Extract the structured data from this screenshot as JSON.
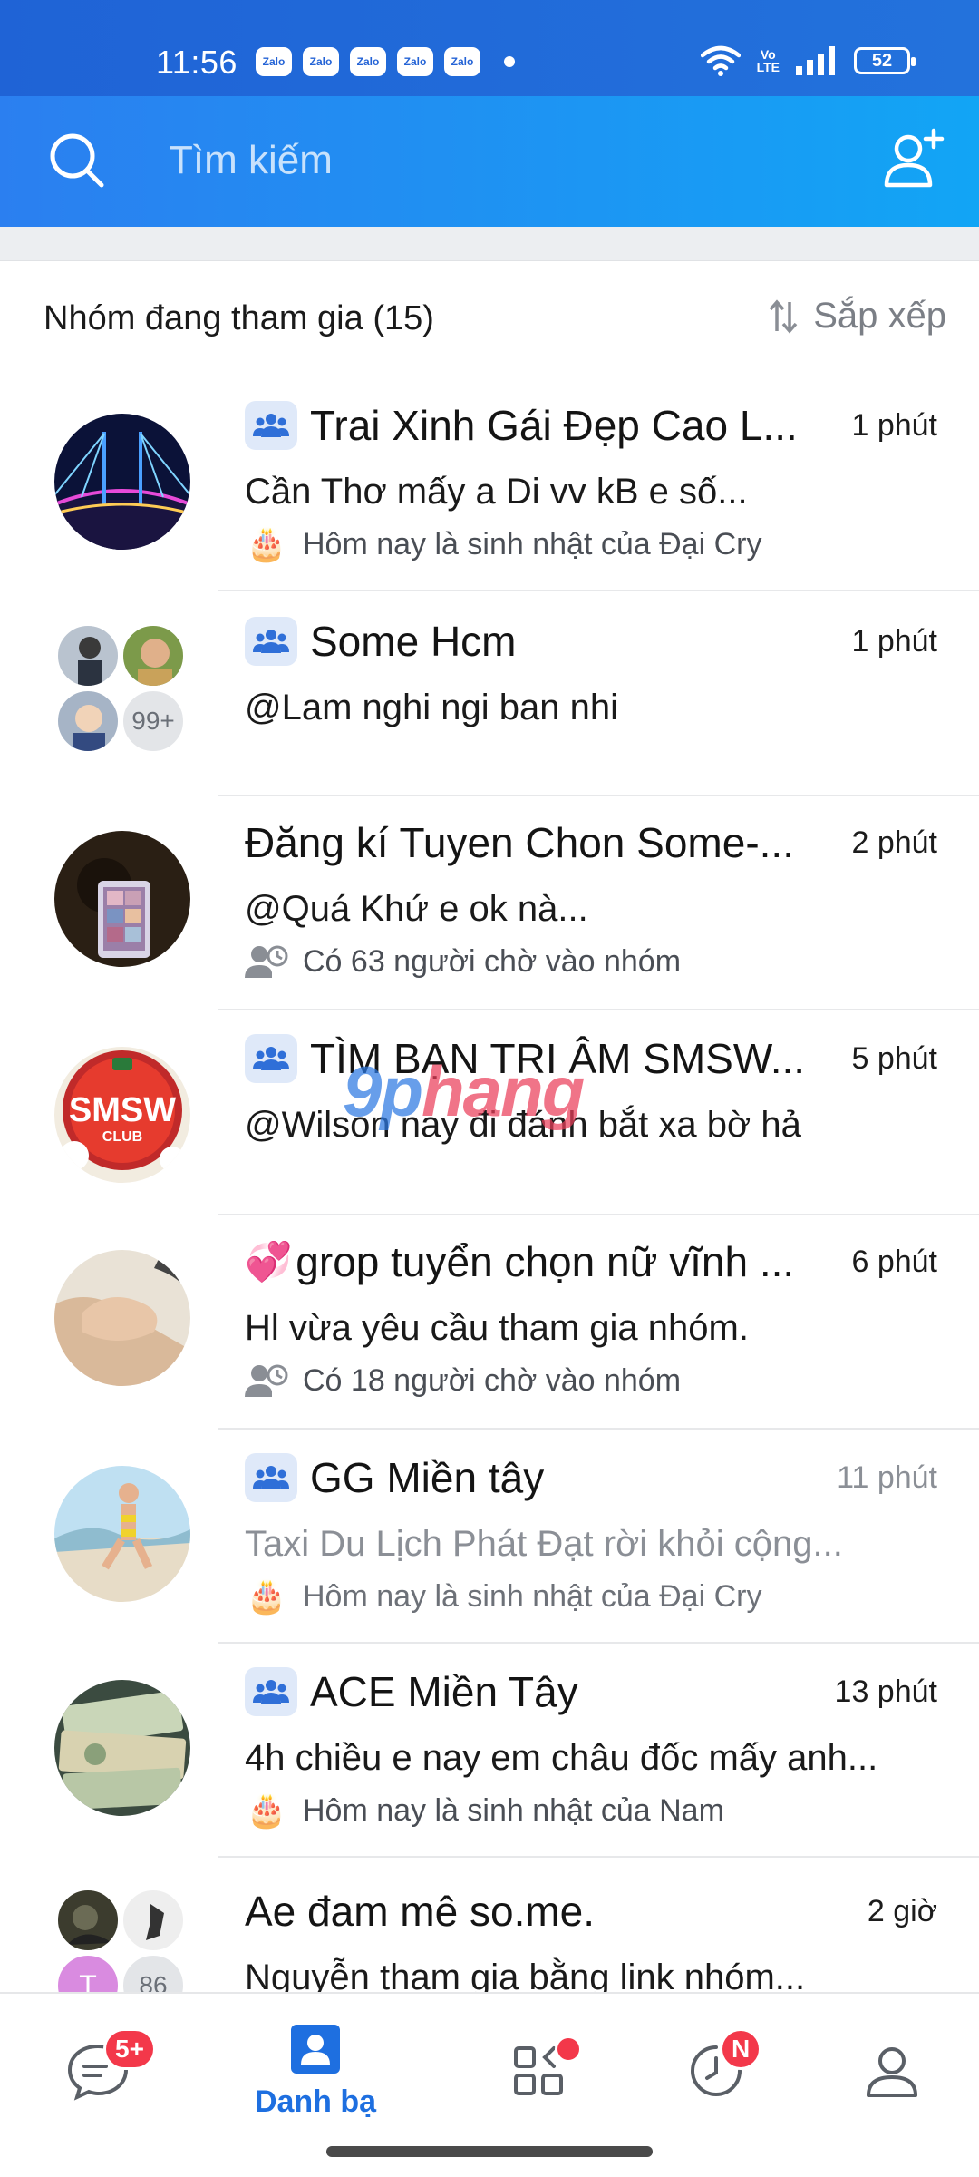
{
  "status_bar": {
    "time": "11:56",
    "notification_app": "Zalo",
    "notification_count_icons": 5,
    "network": "VoLTE",
    "battery": "52"
  },
  "header": {
    "search_placeholder": "Tìm kiếm"
  },
  "section": {
    "title": "Nhóm đang tham gia (15)",
    "sort_label": "Sắp xếp"
  },
  "groups": [
    {
      "name": "Trai Xinh Gái Đẹp Cao L...",
      "time": "1 phút",
      "message": "Cần Thơ mấy a Di vv kB e số...",
      "sub_text": "Hôm nay là sinh nhật của Đại Cry",
      "sub_icon": "birthday-cake-icon",
      "muted": false
    },
    {
      "name": "Some Hcm",
      "time": "1 phút",
      "message": "@Lam nghi ngi ban nhi",
      "member_more": "99+",
      "muted": false
    },
    {
      "name": "Đăng kí Tuyen Chon Some-...",
      "time": "2 phút",
      "message": "@Quá Khứ e ok nà...",
      "sub_text": "Có 63 người chờ vào nhóm",
      "sub_icon": "pending-members-icon",
      "muted": false
    },
    {
      "name": "TÌM BẠN TRI ÂM SMSW...",
      "time": "5 phút",
      "message": "@Wilson nay đi đánh bắt xa bờ hả",
      "avatar_text": "SMSW",
      "avatar_subtext": "CLUB",
      "muted": false
    },
    {
      "name": "grop tuyển chọn nữ vĩnh ...",
      "time": "6 phút",
      "message": "Hl vừa yêu cầu tham gia nhóm.",
      "sub_text": "Có 18 người chờ vào nhóm",
      "sub_icon": "pending-members-icon",
      "name_prefix_icon": "hearts-icon",
      "muted": false
    },
    {
      "name": "GG Miền tây",
      "time": "11 phút",
      "message": "Taxi Du Lịch Phát Đạt rời khỏi cộng...",
      "sub_text": "Hôm nay là sinh nhật của Đại Cry",
      "sub_icon": "birthday-cake-icon",
      "muted": true
    },
    {
      "name": "ACE Miền Tây",
      "time": "13 phút",
      "message": "4h chiều e nay em châu đốc mấy anh...",
      "sub_text": "Hôm nay là sinh nhật của Nam",
      "sub_icon": "birthday-cake-icon",
      "muted": false
    },
    {
      "name": "Ae đam mê so.me.",
      "time": "2 giờ",
      "message": "Nguyễn tham gia bằng link nhóm...",
      "member_initial": "T",
      "member_more": "86",
      "muted": false
    }
  ],
  "watermark": {
    "part1": "9p",
    "part2": "hang"
  },
  "bottom_nav": {
    "messages_badge": "5+",
    "contacts_label": "Danh bạ",
    "timeline_badge": "N",
    "active_color": "#1e6fe0",
    "badge_color": "#f3384a"
  }
}
